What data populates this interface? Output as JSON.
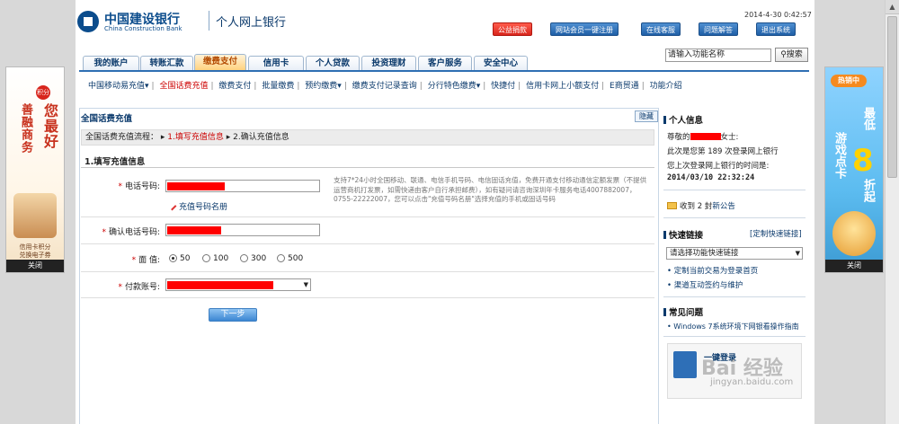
{
  "header": {
    "logo_cn": "中国建设银行",
    "logo_en": "China Construction Bank",
    "product": "个人网上银行",
    "datetime": "2014-4-30 0:42:57",
    "buttons": [
      "公益捐款",
      "网站会员一键注册",
      "在线客服",
      "问题解答",
      "退出系统"
    ]
  },
  "tabs": [
    "我的账户",
    "转账汇款",
    "缴费支付",
    "信用卡",
    "个人贷款",
    "投资理财",
    "客户服务",
    "安全中心"
  ],
  "active_tab": "缴费支付",
  "search": {
    "placeholder": "请输入功能名称",
    "button": "搜索"
  },
  "subnav": [
    "中国移动易充值",
    "全国话费充值",
    "缴费支付",
    "批量缴费",
    "预约缴费",
    "缴费支付记录查询",
    "分行特色缴费",
    "快捷付",
    "信用卡网上小额支付",
    "E商贸通",
    "功能介绍"
  ],
  "subnav_dropdowns": [
    "中国移动易充值",
    "预约缴费",
    "分行特色缴费"
  ],
  "subnav_current": "全国话费充值",
  "main": {
    "title": "全国话费充值",
    "hide_button": "隐藏",
    "flow_label": "全国话费充值流程：",
    "step1": "1.填写充值信息",
    "step2": "2.确认充值信息",
    "section_title": "1.填写充值信息",
    "phone_label": "电话号码:",
    "phone_book_link": "充值号码名册",
    "confirm_label": "确认电话号码:",
    "amount_label": "面  值:",
    "amounts": [
      "50",
      "100",
      "300",
      "500"
    ],
    "amount_selected": "50",
    "account_label": "付款账号:",
    "hint_text": "支持7*24小时全国移动、联通、电信手机号码、电信固话充值，免费开通支付移动通信定额发票（不提供运营商机打发票，如需快递由客户自行承担邮费），如有疑问请咨询深圳年卡服务电话4007882007，0755-22222007，您可以点击\"充值号码名册\"选择充值的手机或固话号码",
    "next_button": "下一步"
  },
  "right": {
    "personal_title": "个人信息",
    "greeting_prefix": "尊敬的",
    "greeting_suffix": "女士:",
    "login_count": "此次是您第 189 次登录网上银行",
    "last_login_label": "您上次登录网上银行的时间是:",
    "last_login_time": "2014/03/10 22:32:24",
    "messages_prefix": "收到 2 封",
    "messages_link": "新公告",
    "quick_title": "快速链接",
    "quick_custom": "[定制快速链接]",
    "quick_select": "请选择功能快速链接",
    "quick_links": [
      "定制当前交易为登录首页",
      "渠道互动签约与维护"
    ],
    "faq_title": "常见问题",
    "faq_links": [
      "Windows 7系统环境下网银看操作指南"
    ],
    "promo_text": "一键登录"
  },
  "ads": {
    "left_top": "积分",
    "left_words": [
      "善融商务",
      "您最好"
    ],
    "left_bottom": [
      "信用卡积分",
      "兑换电子券"
    ],
    "right_top": "热销中",
    "right_words": [
      "游戏点卡",
      "最低",
      "8",
      "折起"
    ],
    "close": "关闭"
  },
  "watermark": "Bai 经验",
  "watermark_url": "jingyan.baidu.com"
}
